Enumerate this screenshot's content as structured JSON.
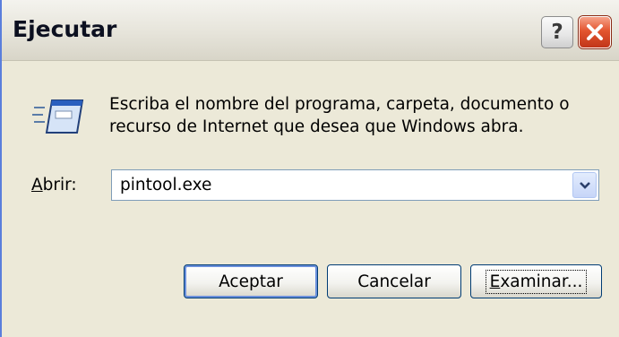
{
  "window": {
    "title": "Ejecutar",
    "help_glyph": "?",
    "close_icon": "close-icon"
  },
  "content": {
    "prompt_line1": "Escriba el nombre del programa, carpeta, documento o",
    "prompt_line2": "recurso de Internet que desea que Windows abra.",
    "run_icon": "run-icon"
  },
  "open_field": {
    "label_accel": "A",
    "label_rest": "brir:",
    "value": "pintool.exe",
    "dropdown_icon": "chevron-down-icon"
  },
  "buttons": {
    "ok_label": "Aceptar",
    "cancel_label": "Cancelar",
    "browse_accel": "E",
    "browse_rest": "xaminar..."
  },
  "colors": {
    "face": "#ece9d8",
    "close_red": "#e3552f",
    "default_outline": "#6b90dc"
  }
}
